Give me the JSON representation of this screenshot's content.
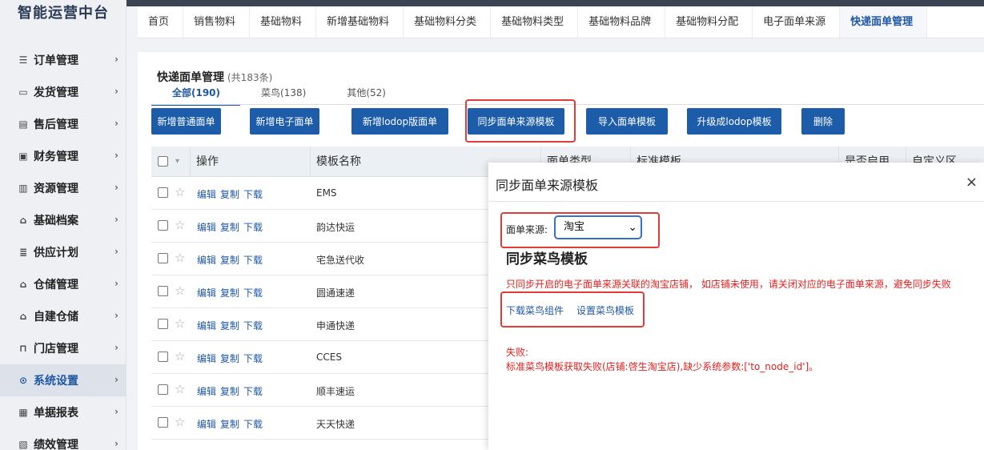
{
  "app": {
    "brand": "智能运营中台"
  },
  "sidebar": {
    "items": [
      {
        "label": "订单管理",
        "icon": "list-icon"
      },
      {
        "label": "发货管理",
        "icon": "truck-icon"
      },
      {
        "label": "售后管理",
        "icon": "clipboard-icon"
      },
      {
        "label": "财务管理",
        "icon": "finance-icon"
      },
      {
        "label": "资源管理",
        "icon": "resource-icon"
      },
      {
        "label": "基础档案",
        "icon": "archive-icon"
      },
      {
        "label": "供应计划",
        "icon": "plan-icon"
      },
      {
        "label": "仓储管理",
        "icon": "warehouse-icon"
      },
      {
        "label": "自建仓储",
        "icon": "building-icon"
      },
      {
        "label": "门店管理",
        "icon": "store-icon"
      },
      {
        "label": "系统设置",
        "icon": "settings-icon"
      },
      {
        "label": "单据报表",
        "icon": "report-icon"
      },
      {
        "label": "绩效管理",
        "icon": "performance-icon"
      }
    ],
    "active_index": 10
  },
  "tabs": [
    "首页",
    "销售物料",
    "基础物料",
    "新增基础物料",
    "基础物料分类",
    "基础物料类型",
    "基础物料品牌",
    "基础物料分配",
    "电子面单来源",
    "快递面单管理"
  ],
  "page": {
    "title": "快递面单管理",
    "count": "(共183条)",
    "subtabs": [
      "全部(190)",
      "菜鸟(138)",
      "其他(52)"
    ]
  },
  "buttons": {
    "new_normal": "新增普通面单",
    "new_electronic": "新增电子面单",
    "new_lodop": "新增lodop版面单",
    "sync_template": "同步面单来源模板",
    "import_template": "导入面单模板",
    "upgrade_lodop": "升级成lodop模板",
    "delete": "删除"
  },
  "table": {
    "headers": {
      "op": "操作",
      "name": "模板名称",
      "type": "面单类型",
      "std": "标准模板",
      "enabled": "是否启用",
      "custom": "自定义区"
    },
    "actions": {
      "edit": "编辑",
      "copy": "复制",
      "download": "下载"
    },
    "rows": [
      "EMS",
      "韵达快运",
      "宅急送代收",
      "圆通速递",
      "申通快递",
      "CCES",
      "顺丰速运",
      "天天快递"
    ]
  },
  "modal": {
    "title": "同步面单来源模板",
    "close": "×",
    "source_label": "面单来源:",
    "source_value": "淘宝",
    "sync_title": "同步菜鸟模板",
    "warning": "只同步开启的电子面单来源关联的淘宝店铺， 如店铺未使用，请关闭对应的电子面单来源，避免同步失败",
    "link_download": "下载菜鸟组件",
    "link_setup": "设置菜鸟模板",
    "fail_title": "失败:",
    "fail_message": "标准菜鸟模板获取失败(店铺:啓生淘宝店),缺少系统参数:['to_node_id']。"
  },
  "colors": {
    "primary": "#1c5ca8",
    "highlight": "#e23b3b",
    "error": "#e02020"
  }
}
